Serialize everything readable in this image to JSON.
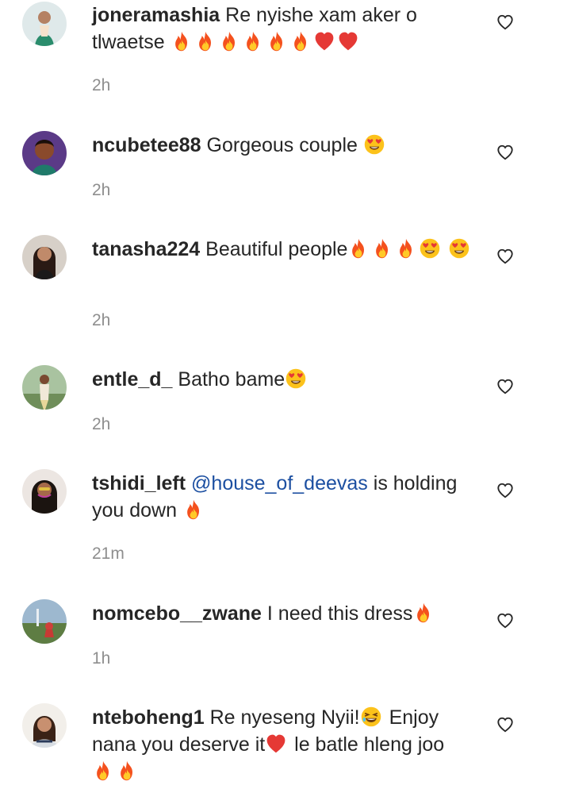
{
  "comments": [
    {
      "username": "joneramashia",
      "text": "Re nyishe xam aker o tlwaetse",
      "emojis": [
        "fire",
        "fire",
        "fire",
        "fire",
        "fire",
        "fire",
        "heart",
        "heart"
      ],
      "time": "2h"
    },
    {
      "username": "ncubetee88",
      "text": "Gorgeous couple",
      "emojis": [
        "heart-eyes"
      ],
      "time": "2h"
    },
    {
      "username": "tanasha224",
      "text": "Beautiful people",
      "emojis": [
        "fire",
        "fire",
        "fire",
        "heart-eyes",
        "heart-eyes"
      ],
      "time": "2h"
    },
    {
      "username": "entle_d_",
      "text": "Batho bame",
      "emojis": [
        "heart-eyes"
      ],
      "time": "2h"
    },
    {
      "username": "tshidi_left",
      "mention": "@house_of_deevas",
      "text": "is holding you down",
      "emojis": [
        "fire"
      ],
      "time": "21m"
    },
    {
      "username": "nomcebo__zwane",
      "text": "I need this dress",
      "emojis": [
        "fire"
      ],
      "time": "1h"
    },
    {
      "username": "nteboheng1",
      "text_a": "Re nyeseng Nyii!",
      "text_b": "Enjoy nana you deserve it",
      "text_c": "le batle hleng joo",
      "emojis": [
        "laughing",
        "heart",
        "fire",
        "fire"
      ],
      "time": ""
    }
  ],
  "icons": {
    "like": "heart-outline-icon",
    "fire": "fire-emoji",
    "heart": "red-heart-emoji",
    "heart-eyes": "heart-eyes-emoji",
    "laughing": "laughing-emoji"
  },
  "colors": {
    "username": "#262626",
    "time": "#8e8e8e",
    "mention": "#1c4fa1"
  }
}
